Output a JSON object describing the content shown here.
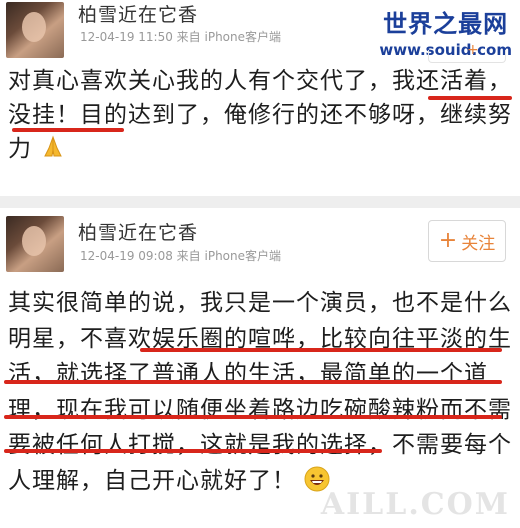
{
  "watermark": {
    "title": "世界之最网",
    "url": "www.souid.com"
  },
  "posts": [
    {
      "author": "柏雪近在它香",
      "meta": "12-04-19 11:50  来自 iPhone客户端",
      "text": "对真心喜欢关心我的人有个交代了，我还活着，没挂！目的达到了，俺修行的还不够呀，继续努力",
      "emoji": "praying-hands"
    },
    {
      "author": "柏雪近在它香",
      "meta": "12-04-19 09:08  来自 iPhone客户端",
      "follow_label": "关注",
      "text": "其实很简单的说，我只是一个演员，也不是什么明星，不喜欢娱乐圈的喧哗，比较向往平淡的生活，就选择了普通人的生活，最简单的一个道理，现在我可以随便坐着路边吃碗酸辣粉而不需要被任何人打搅，这就是我的选择，不需要每个人理解，自己开心就好了！",
      "emoji": "grinning-face"
    }
  ],
  "bottom_watermark": "AILL.COM",
  "colors": {
    "underline": "#d8261b",
    "follow": "#e8843a",
    "watermark": "#1b3f9a"
  }
}
